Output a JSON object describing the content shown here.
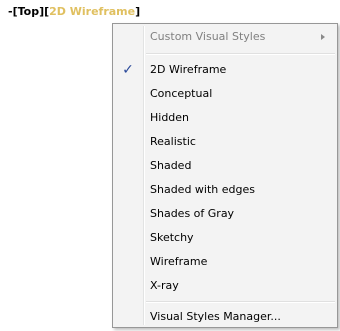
{
  "viewport_controls": {
    "prefix": "-",
    "view": "[Top]",
    "visual_style_open": "[",
    "visual_style": "2D Wireframe",
    "visual_style_close": "]",
    "active_color": "#e0c060"
  },
  "menu": {
    "custom_visual_styles": "Custom Visual Styles",
    "items": [
      {
        "label": "2D Wireframe",
        "checked": true
      },
      {
        "label": "Conceptual",
        "checked": false
      },
      {
        "label": "Hidden",
        "checked": false
      },
      {
        "label": "Realistic",
        "checked": false
      },
      {
        "label": "Shaded",
        "checked": false
      },
      {
        "label": "Shaded with edges",
        "checked": false
      },
      {
        "label": "Shades of Gray",
        "checked": false
      },
      {
        "label": "Sketchy",
        "checked": false
      },
      {
        "label": "Wireframe",
        "checked": false
      },
      {
        "label": "X-ray",
        "checked": false
      }
    ],
    "manager": "Visual Styles Manager...",
    "check_glyph": "✓"
  }
}
